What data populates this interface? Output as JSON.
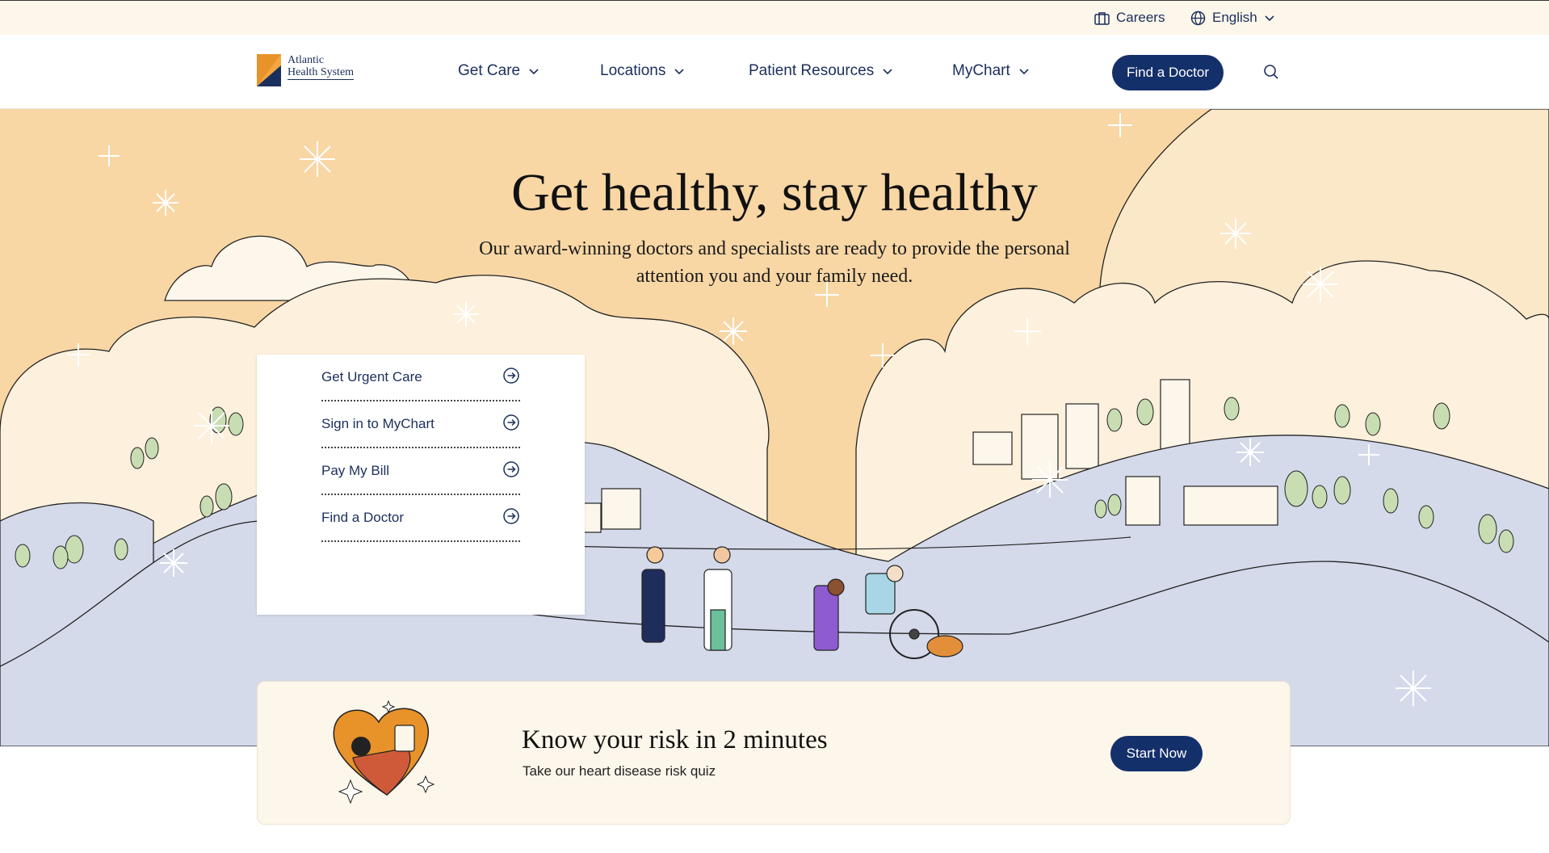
{
  "utility": {
    "careers_label": "Careers",
    "language_label": "English"
  },
  "header": {
    "logo_line1": "Atlantic",
    "logo_line2": "Health System",
    "nav": [
      {
        "label": "Get Care"
      },
      {
        "label": "Locations"
      },
      {
        "label": "Patient Resources"
      },
      {
        "label": "MyChart"
      }
    ],
    "cta_label": "Find a Doctor"
  },
  "hero": {
    "title": "Get healthy, stay healthy",
    "subtitle": "Our award-winning doctors and specialists are ready to provide the personal attention you and your family need."
  },
  "quick_links": [
    {
      "label": "Get Urgent Care"
    },
    {
      "label": "Sign in to MyChart"
    },
    {
      "label": "Pay My Bill"
    },
    {
      "label": "Find a Doctor"
    }
  ],
  "risk_banner": {
    "title": "Know your risk in 2 minutes",
    "subtitle": "Take our heart disease risk quiz",
    "button_label": "Start Now"
  },
  "icons": {
    "careers": "briefcase-icon",
    "language": "globe-icon",
    "dropdown": "chevron-down-icon",
    "search": "search-icon",
    "quick_link": "circle-arrow-right-icon"
  },
  "colors": {
    "brand_navy": "#14306b",
    "hero_sky": "#f8d7a5",
    "hills": "#d4daea",
    "cream": "#fdf6ea",
    "logo_orange": "#e8932a"
  }
}
